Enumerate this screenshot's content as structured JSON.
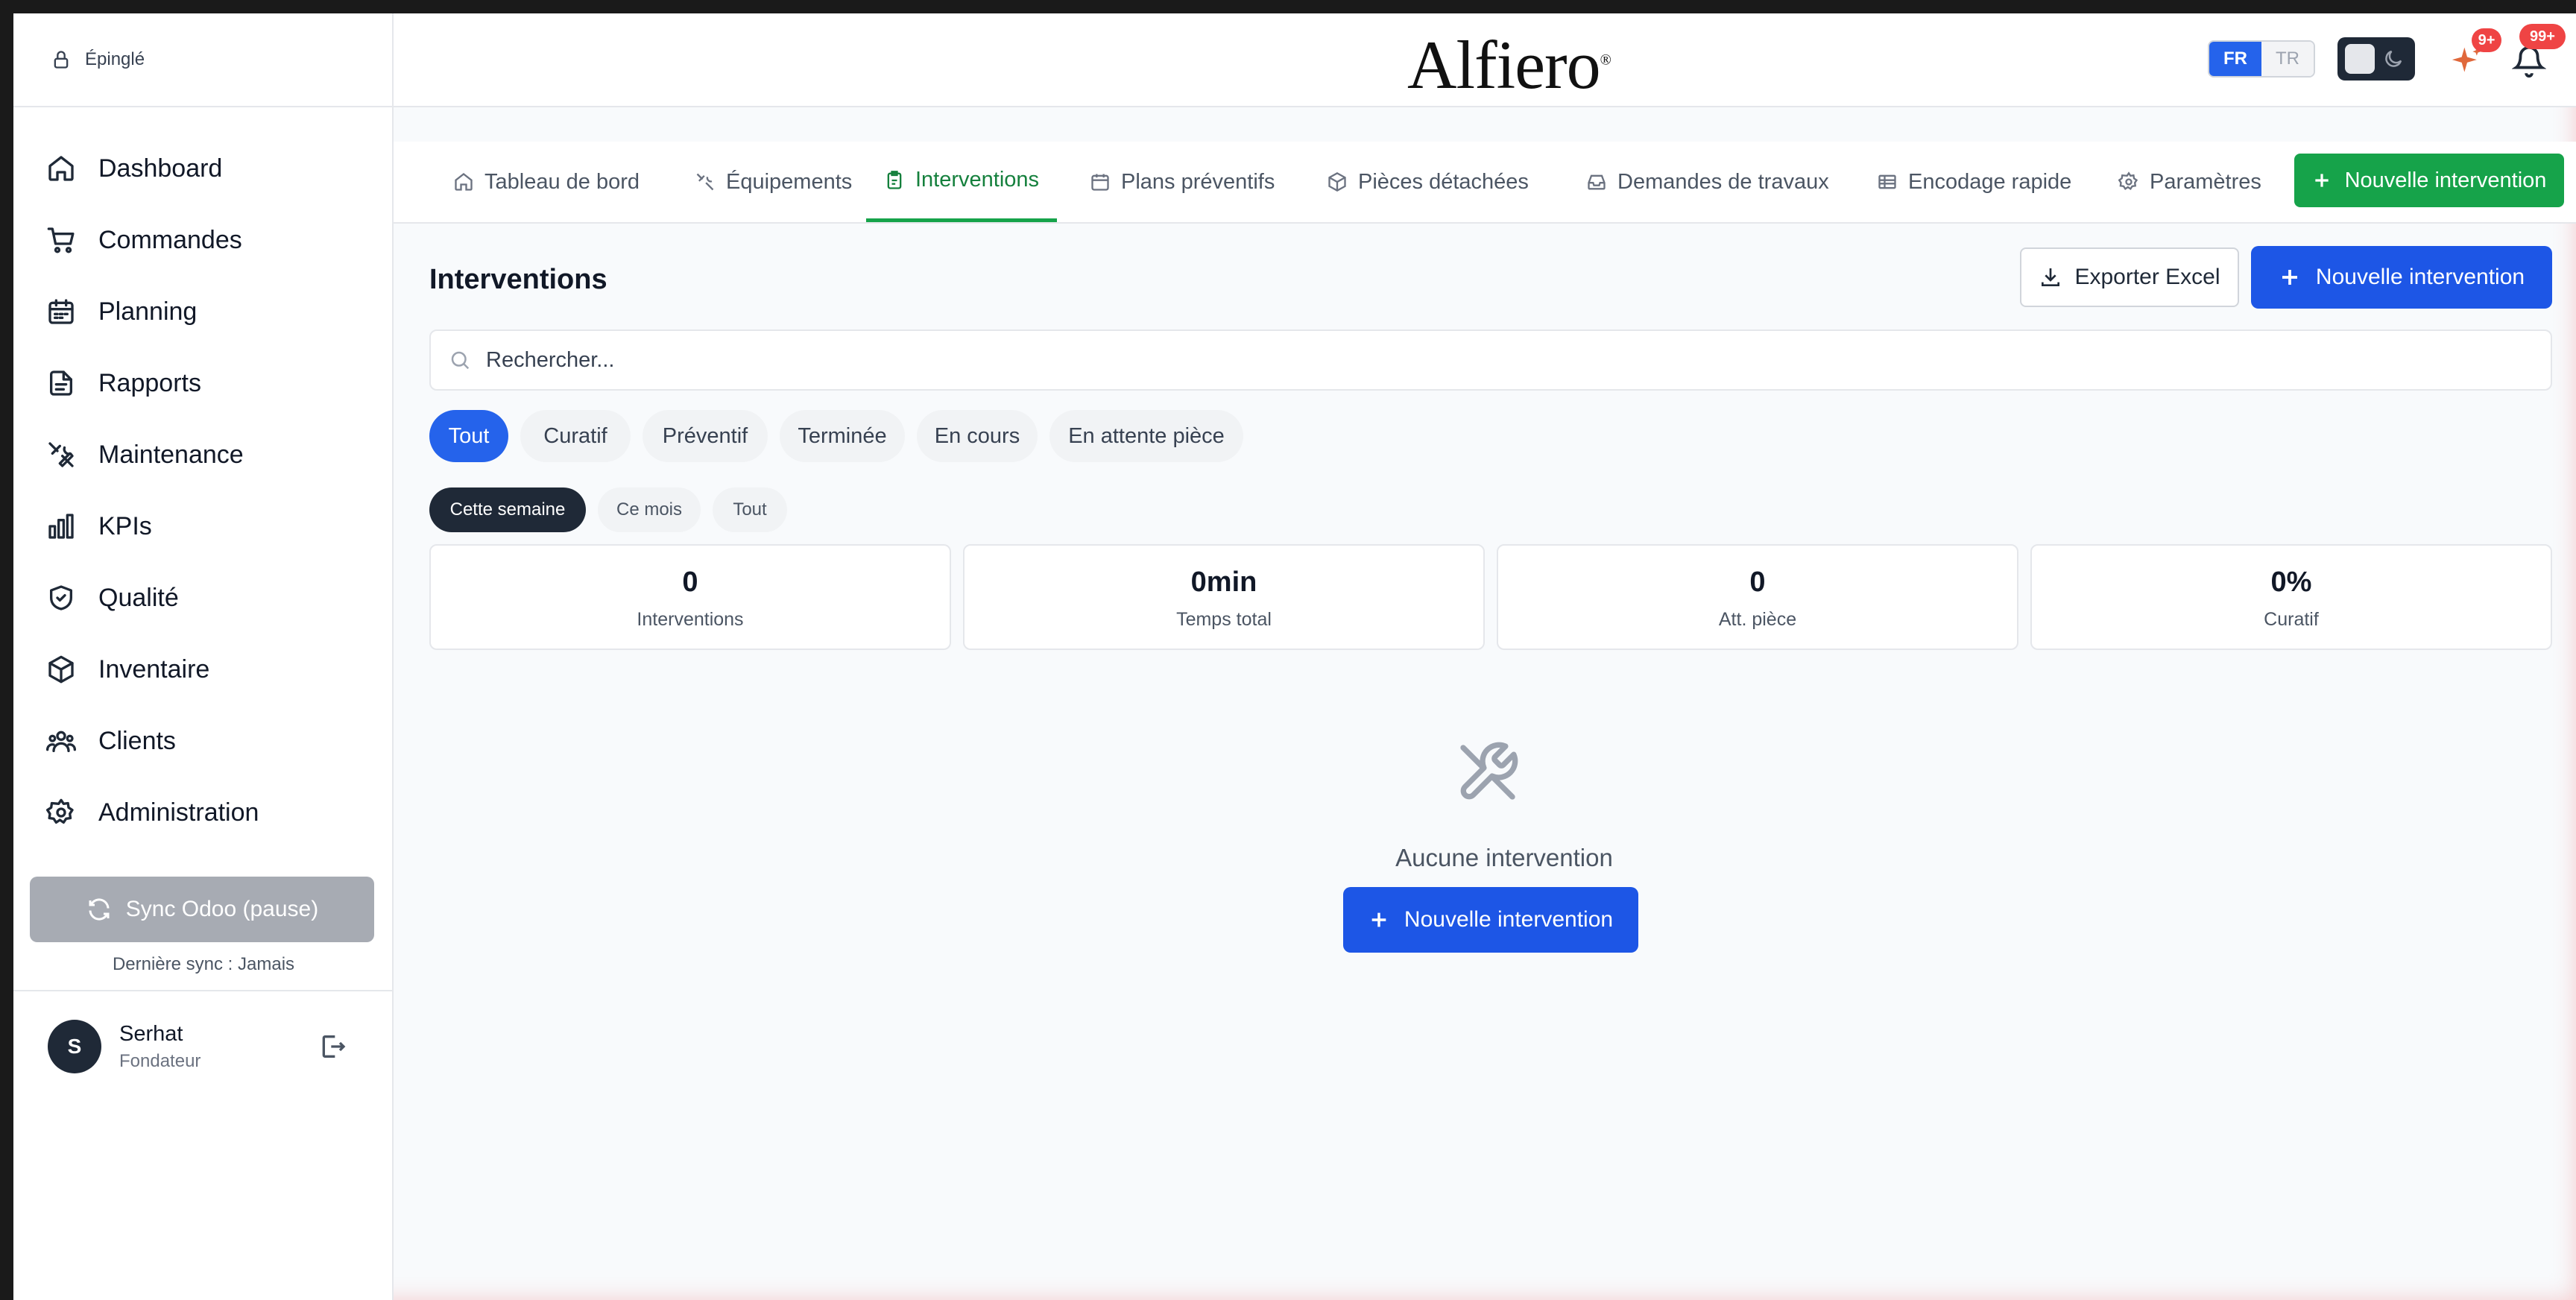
{
  "sidebar": {
    "pin_label": "Épinglé",
    "items": [
      {
        "label": "Dashboard",
        "icon": "home-icon"
      },
      {
        "label": "Commandes",
        "icon": "cart-icon"
      },
      {
        "label": "Planning",
        "icon": "calendar-icon"
      },
      {
        "label": "Rapports",
        "icon": "document-icon"
      },
      {
        "label": "Maintenance",
        "icon": "tools-icon"
      },
      {
        "label": "KPIs",
        "icon": "bar-chart-icon"
      },
      {
        "label": "Qualité",
        "icon": "shield-check-icon"
      },
      {
        "label": "Inventaire",
        "icon": "box-icon"
      },
      {
        "label": "Clients",
        "icon": "users-icon"
      },
      {
        "label": "Administration",
        "icon": "gear-icon"
      }
    ],
    "sync_button": "Sync Odoo (pause)",
    "last_sync": "Dernière sync : Jamais",
    "user": {
      "initial": "S",
      "name": "Serhat",
      "role": "Fondateur"
    }
  },
  "header": {
    "logo": "Alfiero",
    "logo_mark": "®",
    "lang_active": "FR",
    "lang_other": "TR",
    "sparkle_badge": "9+",
    "bell_badge": "99+"
  },
  "tabs": {
    "items": [
      {
        "label": "Tableau de bord"
      },
      {
        "label": "Équipements"
      },
      {
        "label": "Interventions"
      },
      {
        "label": "Plans préventifs"
      },
      {
        "label": "Pièces détachées"
      },
      {
        "label": "Demandes de travaux"
      },
      {
        "label": "Encodage rapide"
      },
      {
        "label": "Paramètres"
      }
    ],
    "new_button": "Nouvelle intervention"
  },
  "main": {
    "title": "Interventions",
    "export_label": "Exporter Excel",
    "new_label": "Nouvelle intervention",
    "search_placeholder": "Rechercher...",
    "type_filters": [
      "Tout",
      "Curatif",
      "Préventif",
      "Terminée",
      "En cours",
      "En attente pièce"
    ],
    "period_filters": [
      "Cette semaine",
      "Ce mois",
      "Tout"
    ],
    "stats": [
      {
        "value": "0",
        "label": "Interventions"
      },
      {
        "value": "0min",
        "label": "Temps total"
      },
      {
        "value": "0",
        "label": "Att. pièce"
      },
      {
        "value": "0%",
        "label": "Curatif"
      }
    ],
    "empty_text": "Aucune intervention",
    "empty_button": "Nouvelle intervention"
  }
}
